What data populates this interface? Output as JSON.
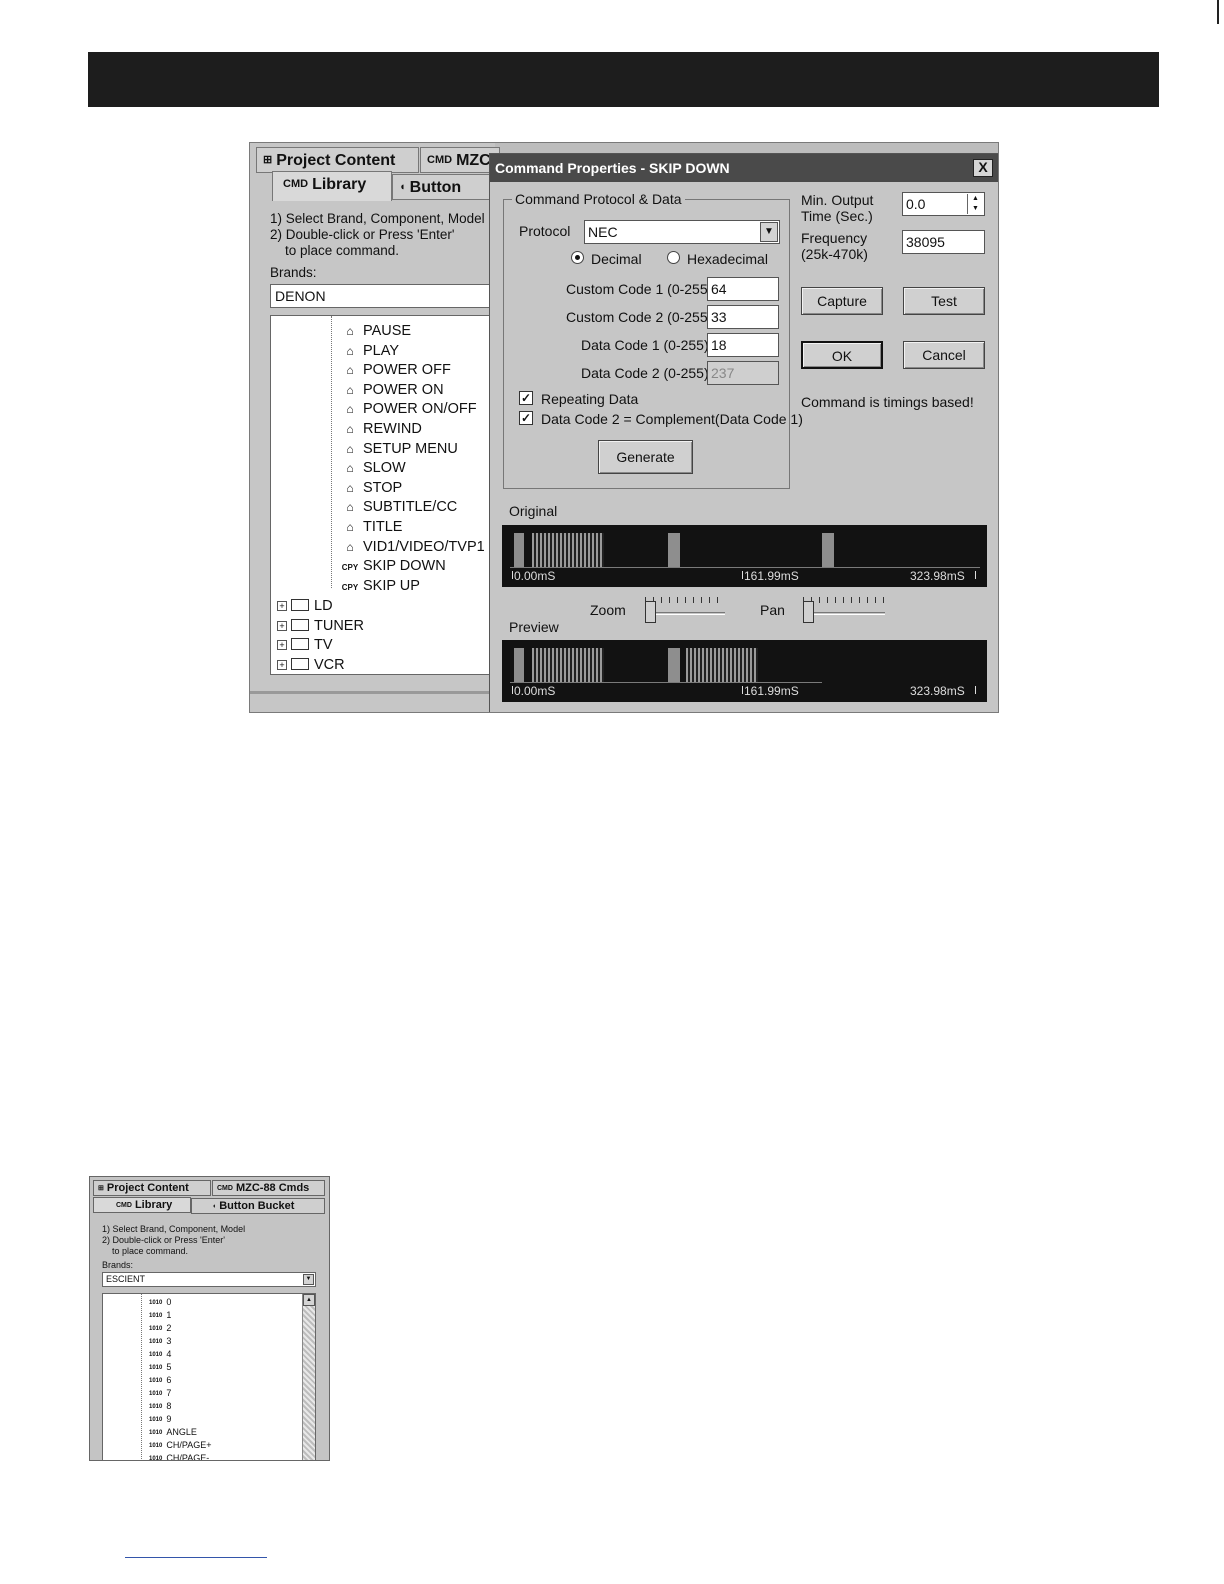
{
  "main": {
    "library": {
      "tabs": {
        "project_content": "Project Content",
        "mzc": "MZC",
        "library": "Library",
        "button": "Button"
      },
      "tab_icons": {
        "project_content": "tree-icon",
        "mzc": "cmd-icon",
        "library": "cmd-icon",
        "button": "bucket-icon"
      },
      "help": "1) Select Brand, Component, Model\n2) Double-click or Press 'Enter'\n    to place command.",
      "brands_label": "Brands:",
      "brand_value": "DENON",
      "commands": [
        {
          "label": "PAUSE",
          "icon": "ir-icon"
        },
        {
          "label": "PLAY",
          "icon": "ir-icon"
        },
        {
          "label": "POWER OFF",
          "icon": "ir-icon"
        },
        {
          "label": "POWER ON",
          "icon": "ir-icon"
        },
        {
          "label": "POWER ON/OFF",
          "icon": "ir-icon"
        },
        {
          "label": "REWIND",
          "icon": "ir-icon"
        },
        {
          "label": "SETUP MENU",
          "icon": "ir-icon"
        },
        {
          "label": "SLOW",
          "icon": "ir-icon"
        },
        {
          "label": "STOP",
          "icon": "ir-icon"
        },
        {
          "label": "SUBTITLE/CC",
          "icon": "ir-icon"
        },
        {
          "label": "TITLE",
          "icon": "ir-icon"
        },
        {
          "label": "VID1/VIDEO/TVP1",
          "icon": "ir-icon"
        },
        {
          "label": "SKIP DOWN",
          "icon": "cpy-icon"
        },
        {
          "label": "SKIP UP",
          "icon": "cpy-icon"
        }
      ],
      "cpy_text": "CPY",
      "folders": [
        "LD",
        "TUNER",
        "TV",
        "VCR"
      ]
    },
    "dialog": {
      "title": "Command Properties - SKIP DOWN",
      "close": "X",
      "group_title": "Command Protocol & Data",
      "protocol_label": "Protocol",
      "protocol_value": "NEC",
      "radio_decimal": "Decimal",
      "radio_hex": "Hexadecimal",
      "decimal_selected": true,
      "custom_code_1_label": "Custom Code 1 (0-255)",
      "custom_code_1": "64",
      "custom_code_2_label": "Custom Code 2 (0-255)",
      "custom_code_2": "33",
      "data_code_1_label": "Data Code 1 (0-255)",
      "data_code_1": "18",
      "data_code_2_label": "Data Code 2 (0-255)",
      "data_code_2": "237",
      "repeating_label": "Repeating Data",
      "repeating_checked": true,
      "complement_label": "Data Code 2 = Complement(Data Code 1)",
      "complement_checked": true,
      "generate": "Generate",
      "min_output_label_1": "Min. Output",
      "min_output_label_2": "Time (Sec.)",
      "min_output_value": "0.0",
      "frequency_label_1": "Frequency",
      "frequency_label_2": "(25k-470k)",
      "frequency_value": "38095",
      "capture": "Capture",
      "test": "Test",
      "ok": "OK",
      "cancel": "Cancel",
      "status": "Command is timings based!",
      "original_label": "Original",
      "preview_label": "Preview",
      "zoom_label": "Zoom",
      "pan_label": "Pan",
      "zoom_level": 0,
      "pan_level": 0,
      "time_start": "0.00mS",
      "time_mid": "161.99mS",
      "time_end": "323.98mS"
    }
  },
  "secondary": {
    "tabs": {
      "project_content": "Project Content",
      "mzc_cmds": "MZC-88 Cmds",
      "library": "Library",
      "button_bucket": "Button Bucket"
    },
    "help": "1) Select Brand, Component, Model\n2) Double-click or Press 'Enter'\n    to place command.",
    "brands_label": "Brands:",
    "brand_value": "ESCIENT",
    "item_icon_text": "1010",
    "items": [
      "0",
      "1",
      "2",
      "3",
      "4",
      "5",
      "6",
      "7",
      "8",
      "9",
      "ANGLE",
      "CH/PAGE+",
      "CH/PAGE-"
    ]
  }
}
